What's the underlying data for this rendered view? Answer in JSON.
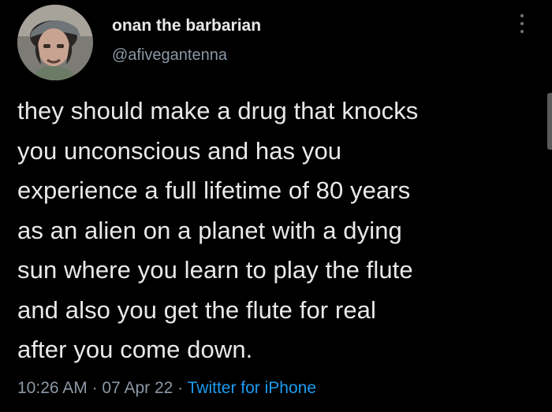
{
  "author": {
    "display_name": "onan the barbarian",
    "handle": "@afivegantenna",
    "avatar_icon": "profile-photo"
  },
  "tweet": {
    "text": "they should make a drug that knocks\nyou unconscious and has you\nexperience a full lifetime of 80 years\nas an alien on a planet with a dying\nsun where you learn to play the flute\nand also you get the flute for real\nafter you come down."
  },
  "meta": {
    "time": "10:26 AM",
    "separator": " · ",
    "date": "07 Apr 22",
    "source": "Twitter for iPhone"
  },
  "menu": {
    "icon": "more-vertical-icon"
  },
  "colors": {
    "background": "#000000",
    "text": "#e7e9ea",
    "secondary": "#8b98a5",
    "accent": "#1d9bf0"
  }
}
